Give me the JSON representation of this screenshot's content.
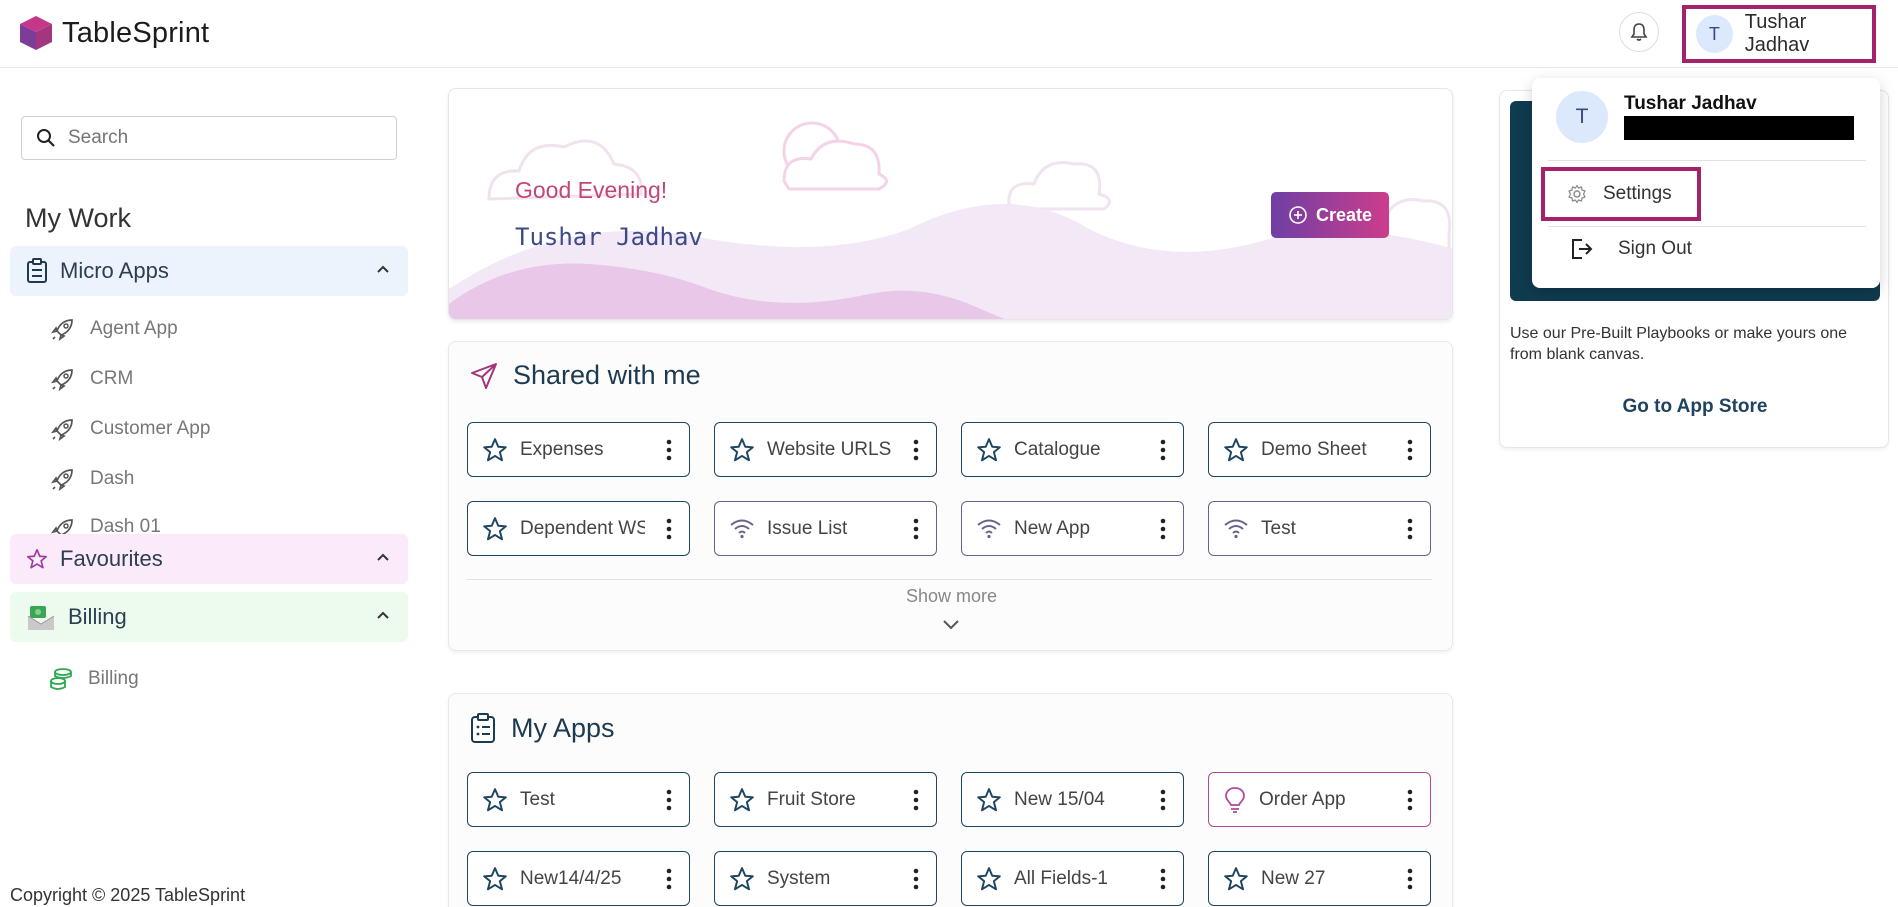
{
  "header": {
    "brand": "TableSprint",
    "user_name": "Tushar Jadhav",
    "avatar_initial": "T"
  },
  "sidebar": {
    "search_placeholder": "Search",
    "my_work": "My Work",
    "micro_apps": {
      "label": "Micro Apps",
      "items": [
        "Agent App",
        "CRM",
        "Customer App",
        "Dash",
        "Dash 01"
      ]
    },
    "favourites": {
      "label": "Favourites"
    },
    "billing": {
      "label": "Billing",
      "items": [
        "Billing"
      ]
    },
    "copyright": "Copyright © 2025 TableSprint"
  },
  "hero": {
    "greeting": "Good Evening!",
    "name": "Tushar Jadhav",
    "create_label": "Create"
  },
  "shared": {
    "title": "Shared with me",
    "items": [
      {
        "label": "Expenses",
        "icon": "star-icon"
      },
      {
        "label": "Website URLS",
        "icon": "star-icon"
      },
      {
        "label": "Catalogue",
        "icon": "star-icon"
      },
      {
        "label": "Demo Sheet",
        "icon": "star-icon"
      },
      {
        "label": "Dependent WS",
        "icon": "star-icon"
      },
      {
        "label": "Issue List",
        "icon": "wifi-icon"
      },
      {
        "label": "New App",
        "icon": "wifi-icon"
      },
      {
        "label": "Test",
        "icon": "wifi-icon"
      }
    ],
    "show_more": "Show more"
  },
  "my_apps": {
    "title": "My Apps",
    "items": [
      {
        "label": "Test",
        "icon": "star-icon"
      },
      {
        "label": "Fruit Store",
        "icon": "star-icon"
      },
      {
        "label": "New 15/04",
        "icon": "star-icon"
      },
      {
        "label": "Order App",
        "icon": "bulb-icon"
      },
      {
        "label": "New14/4/25",
        "icon": "star-icon"
      },
      {
        "label": "System",
        "icon": "star-icon"
      },
      {
        "label": "All Fields-1",
        "icon": "star-icon"
      },
      {
        "label": "New 27",
        "icon": "star-icon"
      }
    ]
  },
  "app_store_card": {
    "text": "Use our Pre-Built Playbooks or make yours one from blank canvas.",
    "link": "Go to App Store"
  },
  "dropdown": {
    "name": "Tushar Jadhav",
    "avatar_initial": "T",
    "settings": "Settings",
    "sign_out": "Sign Out"
  },
  "colors": {
    "highlight": "#a4226b",
    "tile_border": "#1e4660",
    "dark_card": "#0f3b4f"
  }
}
